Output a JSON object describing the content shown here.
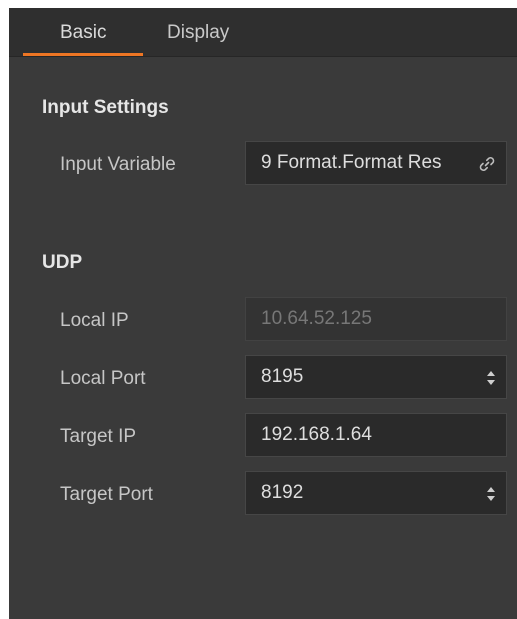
{
  "tabs": [
    {
      "label": "Basic",
      "active": true
    },
    {
      "label": "Display",
      "active": false
    }
  ],
  "accent_color": "#ee7624",
  "input_settings": {
    "title": "Input Settings",
    "input_variable": {
      "label": "Input Variable",
      "value": "9 Format.Format Res",
      "icon": "link-icon"
    }
  },
  "udp": {
    "title": "UDP",
    "local_ip": {
      "label": "Local IP",
      "value": "10.64.52.125",
      "disabled": true
    },
    "local_port": {
      "label": "Local Port",
      "value": "8195",
      "icon": "spinner-icon"
    },
    "target_ip": {
      "label": "Target IP",
      "value": "192.168.1.64"
    },
    "target_port": {
      "label": "Target Port",
      "value": "8192",
      "icon": "spinner-icon"
    }
  }
}
